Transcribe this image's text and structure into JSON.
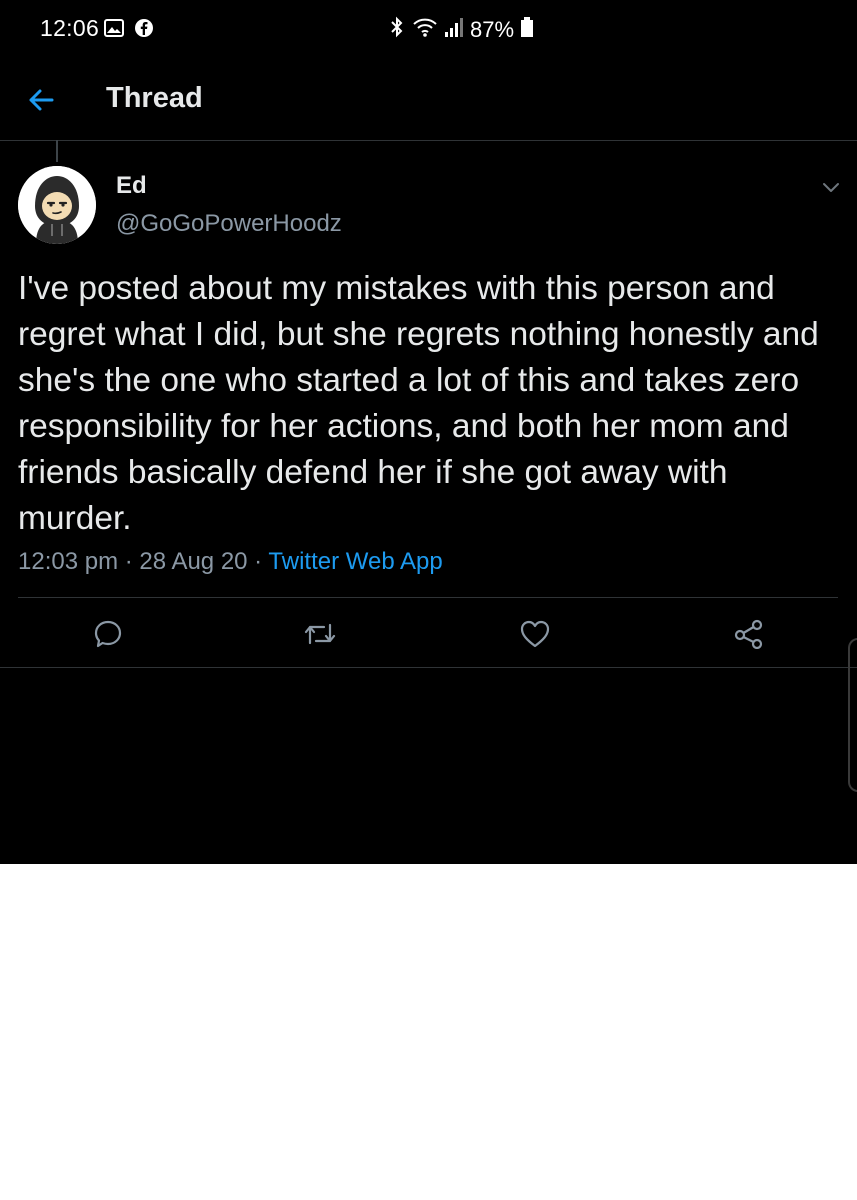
{
  "status_bar": {
    "time": "12:06",
    "battery": "87%",
    "icons": [
      "image-icon",
      "facebook-icon",
      "bluetooth-icon",
      "wifi-icon",
      "signal-icon",
      "battery-icon"
    ]
  },
  "header": {
    "title": "Thread",
    "back_icon": "back-arrow-icon"
  },
  "tweet": {
    "display_name": "Ed",
    "handle": "@GoGoPowerHoodz",
    "text": "I've posted about my mistakes with this person and regret what I did, but she regrets nothing honestly and she's the one who started a lot of this and takes zero responsibility for her actions, and both her mom and friends basically defend her if she got away with murder.",
    "time": "12:03 pm",
    "separator": " · ",
    "date": "28 Aug 20",
    "source": "Twitter Web App",
    "actions": [
      "reply-icon",
      "retweet-icon",
      "like-icon",
      "share-icon"
    ]
  },
  "colors": {
    "background": "#000000",
    "text_primary": "#e7e9ea",
    "text_secondary": "#8b98a5",
    "accent": "#1d9bf0",
    "divider": "#2f3336"
  }
}
